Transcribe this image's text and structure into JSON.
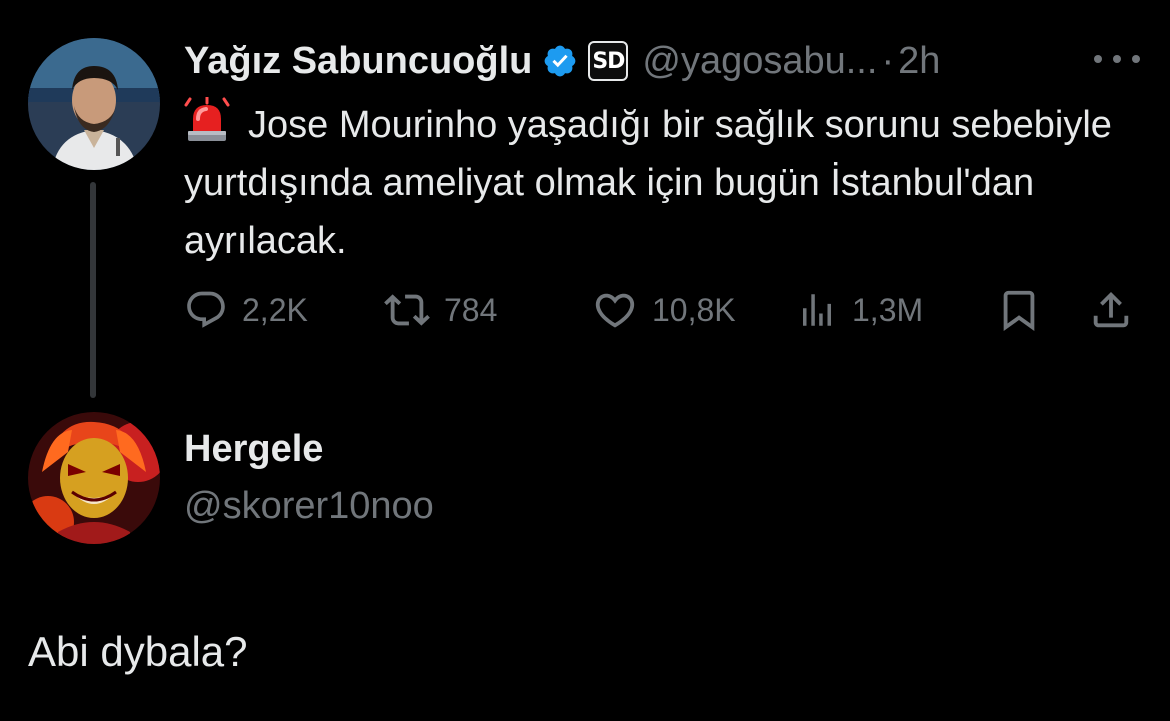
{
  "tweet": {
    "author_name": "Yağız Sabuncuoğlu",
    "handle": "@yagosabu...",
    "separator": "·",
    "time": "2h",
    "text": "Jose Mourinho yaşadığı bir sağlık sorunu sebebiyle yurtdışında ameliyat olmak için bugün İstanbul'dan ayrılacak.",
    "badge_text": "SD",
    "icons": [
      "siren-emoji",
      "verified-badge-icon",
      "sd-logo-badge",
      "more-icon"
    ],
    "actions": {
      "replies": "2,2K",
      "retweets": "784",
      "likes": "10,8K",
      "views": "1,3M"
    },
    "action_icons": [
      "reply-icon",
      "retweet-icon",
      "like-icon",
      "views-icon",
      "bookmark-icon",
      "share-icon"
    ]
  },
  "reply": {
    "author_name": "Hergele",
    "handle": "@skorer10noo",
    "text": "Abi dybala?"
  },
  "colors": {
    "background": "#000000",
    "text_primary": "#e7e9ea",
    "text_secondary": "#71767b",
    "verified_blue": "#1d9bf0",
    "thread_line": "#333639"
  }
}
